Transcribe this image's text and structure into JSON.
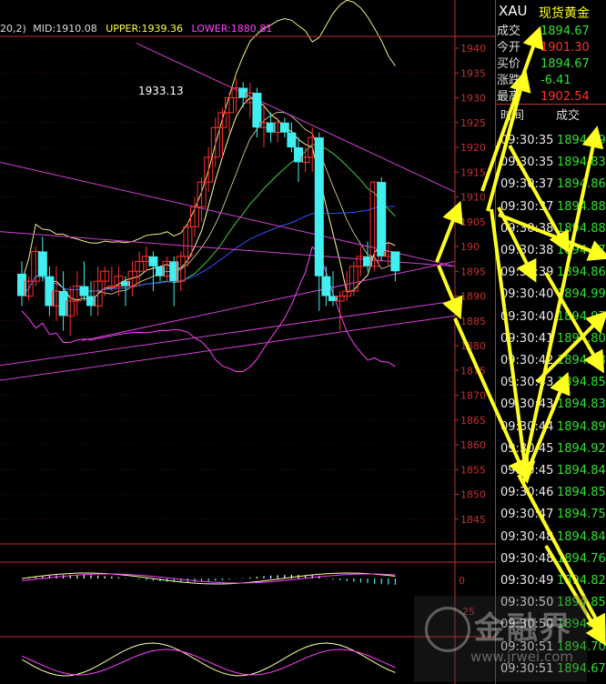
{
  "chart_data": {
    "type": "candlestick",
    "indicator_label": {
      "prefix": "20,2)",
      "mid": "MID:1910.08",
      "upper": "UPPER:1939.36",
      "lower": "LOWER:1880.81"
    },
    "y_axis_ticks": [
      1940,
      1935,
      1930,
      1925,
      1920,
      1915,
      1910,
      1905,
      1900,
      1895,
      1890,
      1885,
      1880,
      1875,
      1870,
      1865,
      1860,
      1855,
      1850,
      1845
    ],
    "y_axis_tick_labels": [
      "1940",
      "1935",
      "1930",
      "1925",
      "1920",
      "1915",
      "1910",
      "1905",
      "190",
      "1895",
      "1890",
      "1885",
      "1880",
      "1875",
      "1870",
      "1865",
      "1860",
      "1855",
      "1850",
      "1845"
    ],
    "ylim": [
      1842,
      1943
    ],
    "annotation": "1933.13",
    "candles": [
      {
        "o": 1894.5,
        "h": 1897,
        "l": 1888,
        "c": 1890
      },
      {
        "o": 1890,
        "h": 1894,
        "l": 1889,
        "c": 1893
      },
      {
        "o": 1893,
        "h": 1900,
        "l": 1892,
        "c": 1899
      },
      {
        "o": 1899,
        "h": 1902,
        "l": 1893,
        "c": 1894
      },
      {
        "o": 1894,
        "h": 1896,
        "l": 1886,
        "c": 1888
      },
      {
        "o": 1888,
        "h": 1896,
        "l": 1885,
        "c": 1891
      },
      {
        "o": 1891,
        "h": 1895,
        "l": 1883,
        "c": 1886
      },
      {
        "o": 1886,
        "h": 1892,
        "l": 1882,
        "c": 1889
      },
      {
        "o": 1889,
        "h": 1895,
        "l": 1886,
        "c": 1892
      },
      {
        "o": 1892,
        "h": 1897,
        "l": 1889,
        "c": 1890
      },
      {
        "o": 1890,
        "h": 1893,
        "l": 1886,
        "c": 1888
      },
      {
        "o": 1888,
        "h": 1896,
        "l": 1886,
        "c": 1893
      },
      {
        "o": 1893,
        "h": 1896,
        "l": 1890,
        "c": 1895
      },
      {
        "o": 1892,
        "h": 1896,
        "l": 1891,
        "c": 1892
      },
      {
        "o": 1892,
        "h": 1896,
        "l": 1890,
        "c": 1894
      },
      {
        "o": 1893,
        "h": 1894,
        "l": 1888,
        "c": 1892
      },
      {
        "o": 1892,
        "h": 1897,
        "l": 1890,
        "c": 1895
      },
      {
        "o": 1895,
        "h": 1899,
        "l": 1892,
        "c": 1897
      },
      {
        "o": 1897,
        "h": 1900,
        "l": 1895,
        "c": 1898
      },
      {
        "o": 1898,
        "h": 1899,
        "l": 1891,
        "c": 1896
      },
      {
        "o": 1896,
        "h": 1896,
        "l": 1893,
        "c": 1894
      },
      {
        "o": 1894,
        "h": 1898,
        "l": 1893,
        "c": 1897
      },
      {
        "o": 1897,
        "h": 1898,
        "l": 1888,
        "c": 1893
      },
      {
        "o": 1893,
        "h": 1899,
        "l": 1891,
        "c": 1898
      },
      {
        "o": 1898,
        "h": 1905,
        "l": 1896,
        "c": 1904
      },
      {
        "o": 1904,
        "h": 1910,
        "l": 1902,
        "c": 1908
      },
      {
        "o": 1908,
        "h": 1914,
        "l": 1905,
        "c": 1913
      },
      {
        "o": 1913,
        "h": 1920,
        "l": 1911,
        "c": 1918
      },
      {
        "o": 1918,
        "h": 1926,
        "l": 1916,
        "c": 1924
      },
      {
        "o": 1924,
        "h": 1928,
        "l": 1918,
        "c": 1927
      },
      {
        "o": 1927,
        "h": 1931,
        "l": 1923,
        "c": 1930
      },
      {
        "o": 1930,
        "h": 1934,
        "l": 1927,
        "c": 1932
      },
      {
        "o": 1932,
        "h": 1933.13,
        "l": 1928,
        "c": 1930
      },
      {
        "o": 1929,
        "h": 1933,
        "l": 1926,
        "c": 1931
      },
      {
        "o": 1931,
        "h": 1932,
        "l": 1922,
        "c": 1924
      },
      {
        "o": 1924,
        "h": 1929,
        "l": 1920,
        "c": 1925
      },
      {
        "o": 1925,
        "h": 1927,
        "l": 1921,
        "c": 1923
      },
      {
        "o": 1923,
        "h": 1926,
        "l": 1921,
        "c": 1925
      },
      {
        "o": 1925,
        "h": 1926,
        "l": 1922,
        "c": 1923
      },
      {
        "o": 1923,
        "h": 1925,
        "l": 1919,
        "c": 1920
      },
      {
        "o": 1920,
        "h": 1922,
        "l": 1913,
        "c": 1917
      },
      {
        "o": 1917,
        "h": 1920,
        "l": 1915,
        "c": 1918
      },
      {
        "o": 1918,
        "h": 1924,
        "l": 1915,
        "c": 1922
      },
      {
        "o": 1922,
        "h": 1923,
        "l": 1887,
        "c": 1894
      },
      {
        "o": 1894,
        "h": 1896,
        "l": 1888,
        "c": 1890
      },
      {
        "o": 1890,
        "h": 1895,
        "l": 1888,
        "c": 1889
      },
      {
        "o": 1889,
        "h": 1891,
        "l": 1883,
        "c": 1890
      },
      {
        "o": 1890,
        "h": 1895,
        "l": 1889,
        "c": 1891
      },
      {
        "o": 1891,
        "h": 1897,
        "l": 1890,
        "c": 1896
      },
      {
        "o": 1896,
        "h": 1900,
        "l": 1894,
        "c": 1898
      },
      {
        "o": 1898,
        "h": 1901,
        "l": 1895,
        "c": 1896
      },
      {
        "o": 1896,
        "h": 1913,
        "l": 1895,
        "c": 1913
      },
      {
        "o": 1913,
        "h": 1914,
        "l": 1897,
        "c": 1898
      },
      {
        "o": 1898,
        "h": 1901,
        "l": 1896,
        "c": 1899
      },
      {
        "o": 1899,
        "h": 1899,
        "l": 1893,
        "c": 1895
      }
    ]
  },
  "quote_header": {
    "symbol": "XAU",
    "name": "现货黄金",
    "rows": [
      {
        "label": "成交",
        "value": "1894.67",
        "color": "green"
      },
      {
        "label": "今开",
        "value": "1901.30",
        "color": "red"
      },
      {
        "label": "买价",
        "value": "1894.67",
        "color": "green"
      },
      {
        "label": "涨跌",
        "value": "-6.41",
        "color": "green"
      },
      {
        "label": "最高",
        "value": "1902.54",
        "color": "red"
      }
    ]
  },
  "ticks": {
    "col_time": "时间",
    "col_price": "成交",
    "rows": [
      {
        "t": "09:30:35",
        "p": "1894.79"
      },
      {
        "t": "09:30:35",
        "p": "1894.83"
      },
      {
        "t": "09:30:37",
        "p": "1894.86"
      },
      {
        "t": "09:30:37",
        "p": "1894.88"
      },
      {
        "t": "09:30:38",
        "p": "1894.88"
      },
      {
        "t": "09:30:38",
        "p": "1894.97"
      },
      {
        "t": "09:30:39",
        "p": "1894.86"
      },
      {
        "t": "09:30:40",
        "p": "1894.99"
      },
      {
        "t": "09:30:40",
        "p": "1894.97"
      },
      {
        "t": "09:30:41",
        "p": "1894.80"
      },
      {
        "t": "09:30:42",
        "p": "1894.88"
      },
      {
        "t": "09:30:43",
        "p": "1894.85"
      },
      {
        "t": "09:30:43",
        "p": "1894.83"
      },
      {
        "t": "09:30:44",
        "p": "1894.89"
      },
      {
        "t": "09:30:45",
        "p": "1894.92"
      },
      {
        "t": "09:30:45",
        "p": "1894.84"
      },
      {
        "t": "09:30:46",
        "p": "1894.85"
      },
      {
        "t": "09:30:47",
        "p": "1894.75"
      },
      {
        "t": "09:30:48",
        "p": "1894.84"
      },
      {
        "t": "09:30:48",
        "p": "1894.76"
      },
      {
        "t": "09:30:49",
        "p": "1894.82"
      },
      {
        "t": "09:30:50",
        "p": "1894.85"
      },
      {
        "t": "09:30:50",
        "p": "1894.77"
      },
      {
        "t": "09:30:51",
        "p": "1894.70"
      },
      {
        "t": "09:30:51",
        "p": "1894.67"
      }
    ]
  },
  "lower_panels": {
    "macd_zero_label": "0",
    "macd_neg_label": "-25"
  },
  "watermark": {
    "text": "金融界",
    "url": "www.jrwei.com"
  },
  "colors": {
    "up": "#ff3030",
    "down": "#40f0f0",
    "upper_band": "#ff40ff",
    "lower_band": "#ff40ff",
    "ma_short": "#ffffa0",
    "ma_mid": "#40d040",
    "ma_long": "#3050ff",
    "arrow": "#ffff20",
    "axis": "#c03030"
  }
}
